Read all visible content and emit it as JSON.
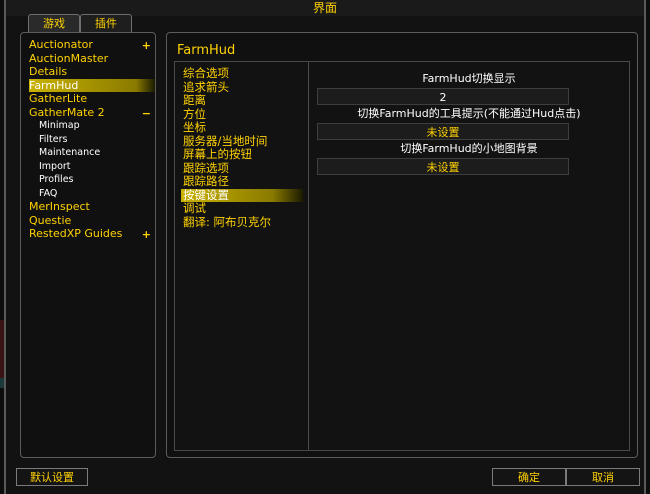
{
  "window": {
    "title": "界面"
  },
  "tabs": [
    {
      "label": "游戏"
    },
    {
      "label": "插件"
    }
  ],
  "addons": [
    {
      "label": "Auctionator",
      "toggle": "+"
    },
    {
      "label": "AuctionMaster"
    },
    {
      "label": "Details"
    },
    {
      "label": "FarmHud",
      "selected": true
    },
    {
      "label": "GatherLite"
    },
    {
      "label": "GatherMate 2",
      "toggle": "−"
    },
    {
      "label": "Minimap",
      "sub": true
    },
    {
      "label": "Filters",
      "sub": true
    },
    {
      "label": "Maintenance",
      "sub": true
    },
    {
      "label": "Import",
      "sub": true
    },
    {
      "label": "Profiles",
      "sub": true
    },
    {
      "label": "FAQ",
      "sub": true
    },
    {
      "label": "MerInspect"
    },
    {
      "label": "Questie"
    },
    {
      "label": "RestedXP Guides",
      "toggle": "+"
    }
  ],
  "panel": {
    "title": "FarmHud",
    "categories": [
      {
        "label": "综合选项"
      },
      {
        "label": "追求箭头"
      },
      {
        "label": "距离"
      },
      {
        "label": "方位"
      },
      {
        "label": "坐标"
      },
      {
        "label": "服务器/当地时间"
      },
      {
        "label": "屏幕上的按钮"
      },
      {
        "label": "跟踪选项"
      },
      {
        "label": "跟踪路径"
      },
      {
        "label": "按键设置",
        "selected": true
      },
      {
        "label": "调试"
      },
      {
        "label": "翻译: 阿布贝克尔"
      }
    ],
    "options": [
      {
        "label": "FarmHud切换显示",
        "value": "2",
        "kind": "value"
      },
      {
        "label": "切换FarmHud的工具提示(不能通过Hud点击)",
        "value": "未设置",
        "kind": "key"
      },
      {
        "label": "切换FarmHud的小地图背景",
        "value": "未设置",
        "kind": "key"
      }
    ]
  },
  "buttons": {
    "defaults": "默认设置",
    "okay": "确定",
    "cancel": "取消"
  }
}
